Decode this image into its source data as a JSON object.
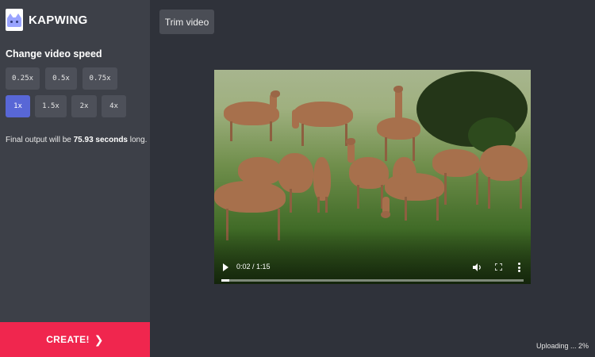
{
  "brand": {
    "name": "KAPWING"
  },
  "sidebar": {
    "title": "Change video speed",
    "speeds": [
      {
        "label": "0.25x",
        "active": false
      },
      {
        "label": "0.5x",
        "active": false
      },
      {
        "label": "0.75x",
        "active": false
      },
      {
        "label": "1x",
        "active": true
      },
      {
        "label": "1.5x",
        "active": false
      },
      {
        "label": "2x",
        "active": false
      },
      {
        "label": "4x",
        "active": false
      }
    ],
    "output_prefix": "Final output will be ",
    "output_value": "75.93 seconds",
    "output_suffix": " long."
  },
  "create_label": "CREATE!",
  "toolbar": {
    "trim_label": "Trim video"
  },
  "player": {
    "time": "0:02 / 1:15",
    "progress_fraction": 0.027,
    "controls_icons": [
      "play-icon",
      "volume-icon",
      "fullscreen-icon",
      "more-options-icon"
    ]
  },
  "status": {
    "upload_text": "Uploading ... 2%"
  },
  "colors": {
    "accent": "#5867d6",
    "create": "#f0264e",
    "sidebar": "#3d4048",
    "background": "#2f323a"
  }
}
